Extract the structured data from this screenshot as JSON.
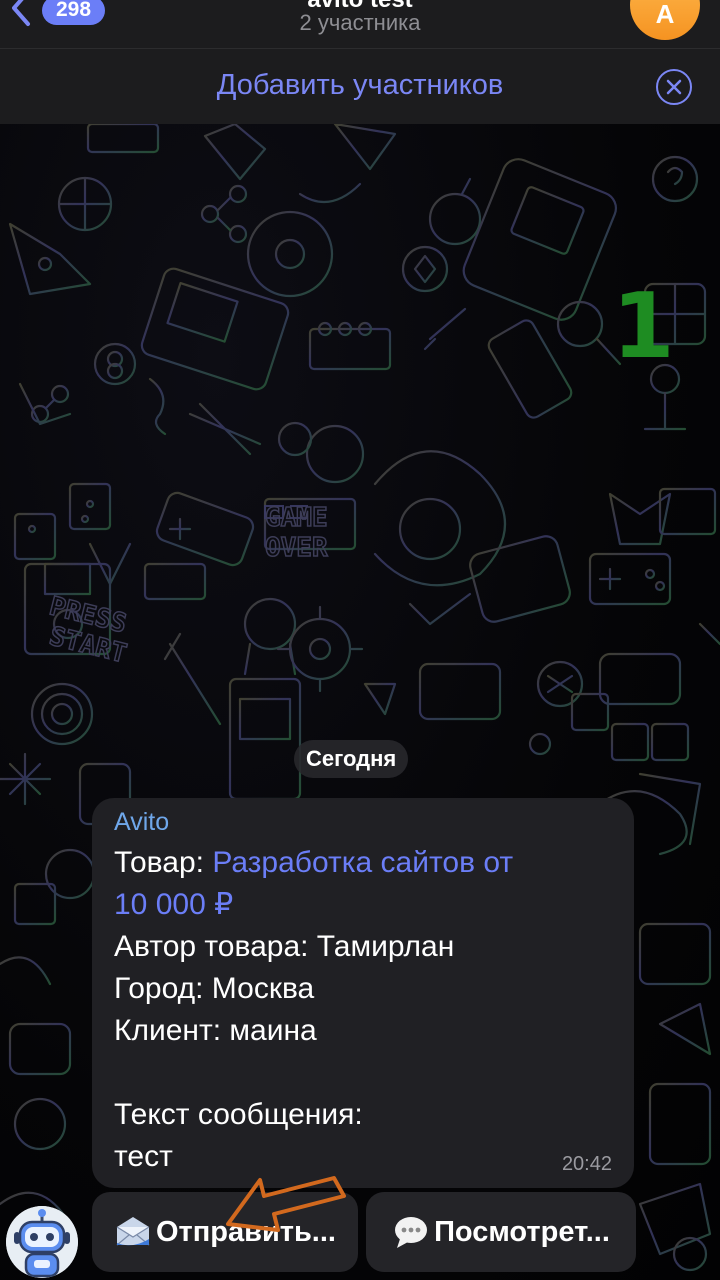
{
  "header": {
    "back_badge": "298",
    "title": "avito test",
    "subtitle": "2 участника",
    "avatar_letter": "A"
  },
  "add_bar": {
    "label": "Добавить участников"
  },
  "overlay": {
    "number": "1"
  },
  "chat": {
    "date_label": "Сегодня",
    "message": {
      "sender": "Avito",
      "product_label": "Товар: ",
      "product_link_line1": "Разработка сайтов от",
      "product_link_line2": "10 000 ₽",
      "author_line": "Автор товара: Тамирлан",
      "city_line": "Город: Москва",
      "client_line": "Клиент: маина",
      "text_label": "Текст сообщения:",
      "text_value": "тест",
      "time": "20:42"
    },
    "buttons": {
      "send_label": "Отправить...",
      "view_label": "Посмотрет..."
    }
  },
  "colors": {
    "accent": "#6b7ef7",
    "sender": "#6fa7ea",
    "overlay_number": "#1e8c22",
    "arrow": "#d2691e"
  },
  "icons": [
    "chevron-left-icon",
    "close-circle-icon",
    "envelope-icon",
    "speech-bubble-icon",
    "robot-icon",
    "arrow-annotation-icon"
  ]
}
